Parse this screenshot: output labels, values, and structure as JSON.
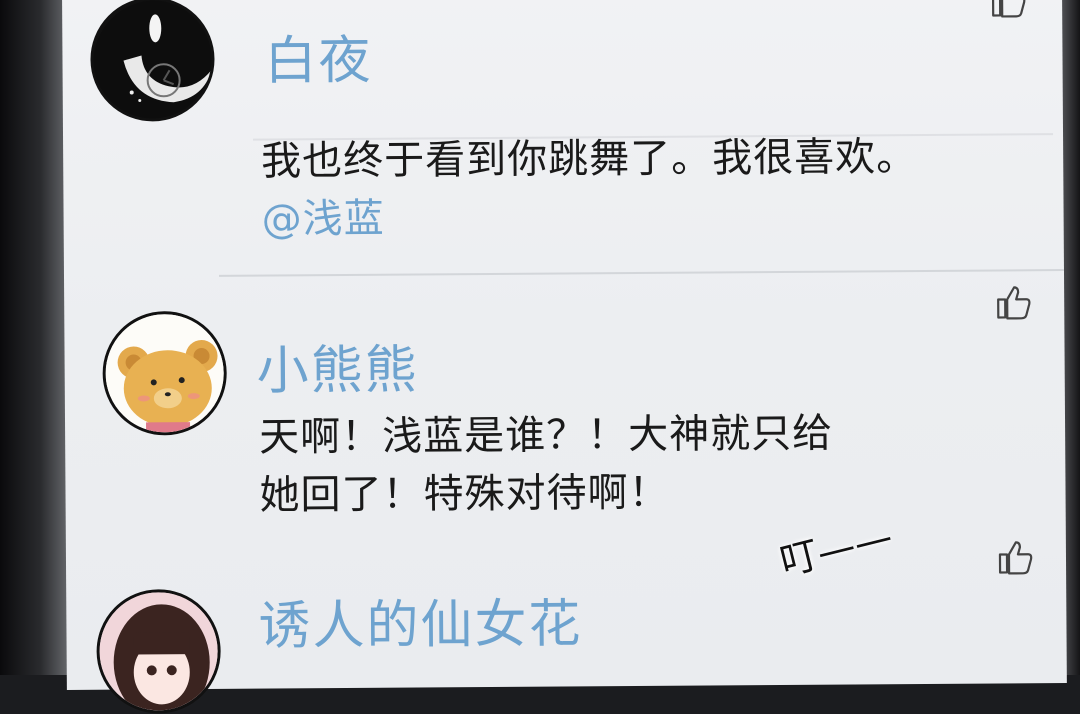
{
  "comments": [
    {
      "username": "白夜",
      "text": "我也终于看到你跳舞了。我很喜欢。",
      "mention": "@浅蓝",
      "avatar_icon": "moon-clock-avatar",
      "like_icon": "thumbs-up-icon"
    },
    {
      "username": "小熊熊",
      "text_line1": "天啊！浅蓝是谁？！大神就只给",
      "text_line2": "她回了！特殊对待啊！",
      "avatar_icon": "bear-avatar",
      "like_icon": "thumbs-up-icon"
    },
    {
      "username": "诱人的仙女花",
      "avatar_icon": "anime-girl-avatar",
      "like_icon": "thumbs-up-icon"
    }
  ],
  "sfx": "叮——",
  "colors": {
    "username": "#6ea3cf",
    "body_text": "#1a1a1a",
    "background": "#eceef1"
  }
}
